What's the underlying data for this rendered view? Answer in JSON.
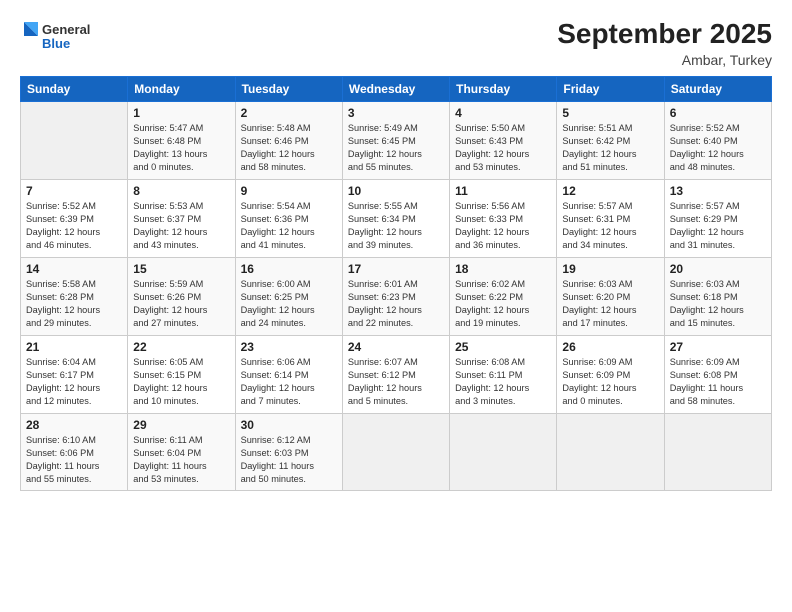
{
  "header": {
    "logo_general": "General",
    "logo_blue": "Blue",
    "month": "September 2025",
    "location": "Ambar, Turkey"
  },
  "days_of_week": [
    "Sunday",
    "Monday",
    "Tuesday",
    "Wednesday",
    "Thursday",
    "Friday",
    "Saturday"
  ],
  "weeks": [
    [
      {
        "day": "",
        "info": ""
      },
      {
        "day": "1",
        "info": "Sunrise: 5:47 AM\nSunset: 6:48 PM\nDaylight: 13 hours\nand 0 minutes."
      },
      {
        "day": "2",
        "info": "Sunrise: 5:48 AM\nSunset: 6:46 PM\nDaylight: 12 hours\nand 58 minutes."
      },
      {
        "day": "3",
        "info": "Sunrise: 5:49 AM\nSunset: 6:45 PM\nDaylight: 12 hours\nand 55 minutes."
      },
      {
        "day": "4",
        "info": "Sunrise: 5:50 AM\nSunset: 6:43 PM\nDaylight: 12 hours\nand 53 minutes."
      },
      {
        "day": "5",
        "info": "Sunrise: 5:51 AM\nSunset: 6:42 PM\nDaylight: 12 hours\nand 51 minutes."
      },
      {
        "day": "6",
        "info": "Sunrise: 5:52 AM\nSunset: 6:40 PM\nDaylight: 12 hours\nand 48 minutes."
      }
    ],
    [
      {
        "day": "7",
        "info": "Sunrise: 5:52 AM\nSunset: 6:39 PM\nDaylight: 12 hours\nand 46 minutes."
      },
      {
        "day": "8",
        "info": "Sunrise: 5:53 AM\nSunset: 6:37 PM\nDaylight: 12 hours\nand 43 minutes."
      },
      {
        "day": "9",
        "info": "Sunrise: 5:54 AM\nSunset: 6:36 PM\nDaylight: 12 hours\nand 41 minutes."
      },
      {
        "day": "10",
        "info": "Sunrise: 5:55 AM\nSunset: 6:34 PM\nDaylight: 12 hours\nand 39 minutes."
      },
      {
        "day": "11",
        "info": "Sunrise: 5:56 AM\nSunset: 6:33 PM\nDaylight: 12 hours\nand 36 minutes."
      },
      {
        "day": "12",
        "info": "Sunrise: 5:57 AM\nSunset: 6:31 PM\nDaylight: 12 hours\nand 34 minutes."
      },
      {
        "day": "13",
        "info": "Sunrise: 5:57 AM\nSunset: 6:29 PM\nDaylight: 12 hours\nand 31 minutes."
      }
    ],
    [
      {
        "day": "14",
        "info": "Sunrise: 5:58 AM\nSunset: 6:28 PM\nDaylight: 12 hours\nand 29 minutes."
      },
      {
        "day": "15",
        "info": "Sunrise: 5:59 AM\nSunset: 6:26 PM\nDaylight: 12 hours\nand 27 minutes."
      },
      {
        "day": "16",
        "info": "Sunrise: 6:00 AM\nSunset: 6:25 PM\nDaylight: 12 hours\nand 24 minutes."
      },
      {
        "day": "17",
        "info": "Sunrise: 6:01 AM\nSunset: 6:23 PM\nDaylight: 12 hours\nand 22 minutes."
      },
      {
        "day": "18",
        "info": "Sunrise: 6:02 AM\nSunset: 6:22 PM\nDaylight: 12 hours\nand 19 minutes."
      },
      {
        "day": "19",
        "info": "Sunrise: 6:03 AM\nSunset: 6:20 PM\nDaylight: 12 hours\nand 17 minutes."
      },
      {
        "day": "20",
        "info": "Sunrise: 6:03 AM\nSunset: 6:18 PM\nDaylight: 12 hours\nand 15 minutes."
      }
    ],
    [
      {
        "day": "21",
        "info": "Sunrise: 6:04 AM\nSunset: 6:17 PM\nDaylight: 12 hours\nand 12 minutes."
      },
      {
        "day": "22",
        "info": "Sunrise: 6:05 AM\nSunset: 6:15 PM\nDaylight: 12 hours\nand 10 minutes."
      },
      {
        "day": "23",
        "info": "Sunrise: 6:06 AM\nSunset: 6:14 PM\nDaylight: 12 hours\nand 7 minutes."
      },
      {
        "day": "24",
        "info": "Sunrise: 6:07 AM\nSunset: 6:12 PM\nDaylight: 12 hours\nand 5 minutes."
      },
      {
        "day": "25",
        "info": "Sunrise: 6:08 AM\nSunset: 6:11 PM\nDaylight: 12 hours\nand 3 minutes."
      },
      {
        "day": "26",
        "info": "Sunrise: 6:09 AM\nSunset: 6:09 PM\nDaylight: 12 hours\nand 0 minutes."
      },
      {
        "day": "27",
        "info": "Sunrise: 6:09 AM\nSunset: 6:08 PM\nDaylight: 11 hours\nand 58 minutes."
      }
    ],
    [
      {
        "day": "28",
        "info": "Sunrise: 6:10 AM\nSunset: 6:06 PM\nDaylight: 11 hours\nand 55 minutes."
      },
      {
        "day": "29",
        "info": "Sunrise: 6:11 AM\nSunset: 6:04 PM\nDaylight: 11 hours\nand 53 minutes."
      },
      {
        "day": "30",
        "info": "Sunrise: 6:12 AM\nSunset: 6:03 PM\nDaylight: 11 hours\nand 50 minutes."
      },
      {
        "day": "",
        "info": ""
      },
      {
        "day": "",
        "info": ""
      },
      {
        "day": "",
        "info": ""
      },
      {
        "day": "",
        "info": ""
      }
    ]
  ]
}
